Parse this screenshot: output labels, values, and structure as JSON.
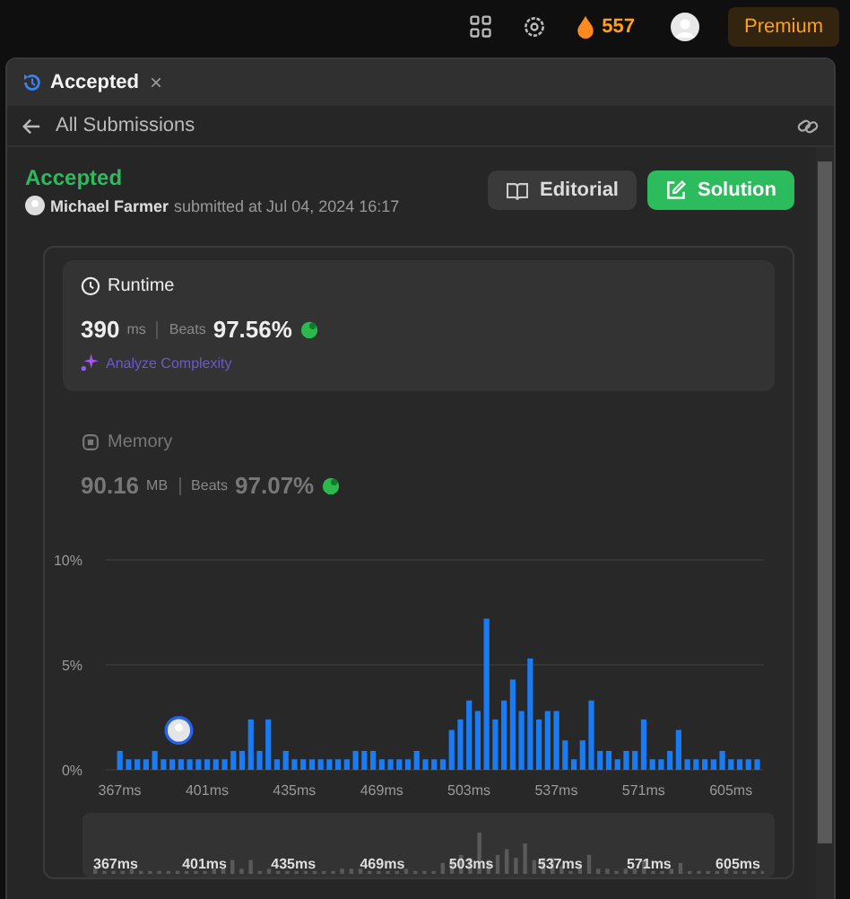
{
  "topbar": {
    "streak": "557",
    "premium": "Premium"
  },
  "tab": {
    "title": "Accepted",
    "close": "×"
  },
  "nav": {
    "back": "All Submissions"
  },
  "submission": {
    "status": "Accepted",
    "user": "Michael Farmer",
    "submitted": "submitted at Jul 04, 2024 16:17"
  },
  "buttons": [
    {
      "label": "Editorial",
      "kind": "secondary"
    },
    {
      "label": "Solution",
      "kind": "primary"
    }
  ],
  "runtime": {
    "title": "Runtime",
    "value": "390",
    "unit": "ms",
    "beats_label": "Beats",
    "beats": "97.56%",
    "analyze": "Analyze Complexity",
    "selected": true
  },
  "memory": {
    "title": "Memory",
    "value": "90.16",
    "unit": "MB",
    "beats_label": "Beats",
    "beats": "97.07%",
    "selected": false
  },
  "chart": {
    "chart_data": {
      "type": "bar",
      "xlim": [
        362.6,
        618.9
      ],
      "ylim": [
        0,
        10
      ],
      "yticks": [
        {
          "value": 0,
          "label": "0%"
        },
        {
          "value": 5,
          "label": "5%"
        },
        {
          "value": 10,
          "label": "10%"
        }
      ],
      "xticks": [
        {
          "value": 367,
          "label": "367ms"
        },
        {
          "value": 401,
          "label": "401ms"
        },
        {
          "value": 435,
          "label": "435ms"
        },
        {
          "value": 469,
          "label": "469ms"
        },
        {
          "value": 503,
          "label": "503ms"
        },
        {
          "value": 537,
          "label": "537ms"
        },
        {
          "value": 571,
          "label": "571ms"
        },
        {
          "value": 605,
          "label": "605ms"
        }
      ],
      "x": [
        367,
        370.4,
        373.8,
        377.2,
        380.6,
        384,
        387.4,
        390.8,
        394.2,
        397.6,
        401,
        404.4,
        407.8,
        411.2,
        414.6,
        418,
        421.4,
        424.8,
        428.2,
        431.6,
        435,
        438.4,
        441.8,
        445.2,
        448.6,
        452,
        455.4,
        458.8,
        462.2,
        465.6,
        469,
        472.4,
        475.8,
        479.2,
        482.6,
        486,
        489.4,
        492.8,
        496.2,
        499.6,
        503,
        506.4,
        509.8,
        513.2,
        516.6,
        520,
        523.4,
        526.8,
        530.2,
        533.6,
        537,
        540.4,
        543.8,
        547.2,
        550.6,
        554,
        557.4,
        560.8,
        564.2,
        567.6,
        571,
        574.4,
        577.8,
        581.2,
        584.6,
        588,
        591.4,
        594.8,
        598.2,
        601.6,
        605,
        608.4,
        611.8,
        615.2
      ],
      "values": [
        0.9,
        0.5,
        0.5,
        0.5,
        0.9,
        0.5,
        0.5,
        0.5,
        0.5,
        0.5,
        0.5,
        0.5,
        0.5,
        0.9,
        0.9,
        2.4,
        0.9,
        2.4,
        0.5,
        0.9,
        0.5,
        0.5,
        0.5,
        0.5,
        0.5,
        0.5,
        0.5,
        0.9,
        0.9,
        0.9,
        0.5,
        0.5,
        0.5,
        0.5,
        0.9,
        0.5,
        0.5,
        0.5,
        1.9,
        2.4,
        3.3,
        2.8,
        7.2,
        2.4,
        3.3,
        4.3,
        2.8,
        5.3,
        2.4,
        2.8,
        2.8,
        1.4,
        0.5,
        1.4,
        3.3,
        0.9,
        0.9,
        0.5,
        0.9,
        0.9,
        2.4,
        0.5,
        0.5,
        0.9,
        1.9,
        0.5,
        0.5,
        0.5,
        0.5,
        0.9,
        0.5,
        0.5,
        0.5,
        0.5
      ]
    },
    "minimap_labels": [
      "367ms",
      "401ms",
      "435ms",
      "469ms",
      "503ms",
      "537ms",
      "571ms",
      "605ms"
    ]
  }
}
